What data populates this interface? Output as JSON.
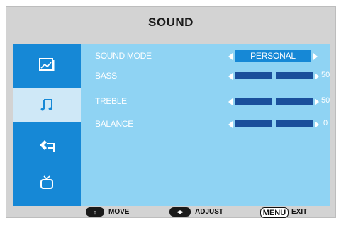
{
  "title": "SOUND",
  "sidebar": {
    "items": [
      {
        "name": "picture",
        "icon": "picture-icon"
      },
      {
        "name": "sound",
        "icon": "music-note-icon",
        "selected": true
      },
      {
        "name": "setup",
        "icon": "setup-tool-icon"
      },
      {
        "name": "tv",
        "icon": "tv-icon"
      }
    ]
  },
  "settings": {
    "sound_mode": {
      "label": "SOUND MODE",
      "value": "PERSONAL"
    },
    "bass": {
      "label": "BASS",
      "value": "50",
      "level": 0.5
    },
    "treble": {
      "label": "TREBLE",
      "value": "50",
      "level": 0.5
    },
    "balance": {
      "label": "BALANCE",
      "value": "0",
      "level": 0.5
    }
  },
  "footer": {
    "move_key": "↕",
    "move_label": "MOVE",
    "adjust_key": "◂▸",
    "adjust_label": "ADJUST",
    "menu_key": "MENU",
    "exit_label": "EXIT"
  },
  "colors": {
    "accent": "#1688d6",
    "panel": "#8fd3f3",
    "bar": "#1a4f9b",
    "frame": "#d3d3d3"
  }
}
